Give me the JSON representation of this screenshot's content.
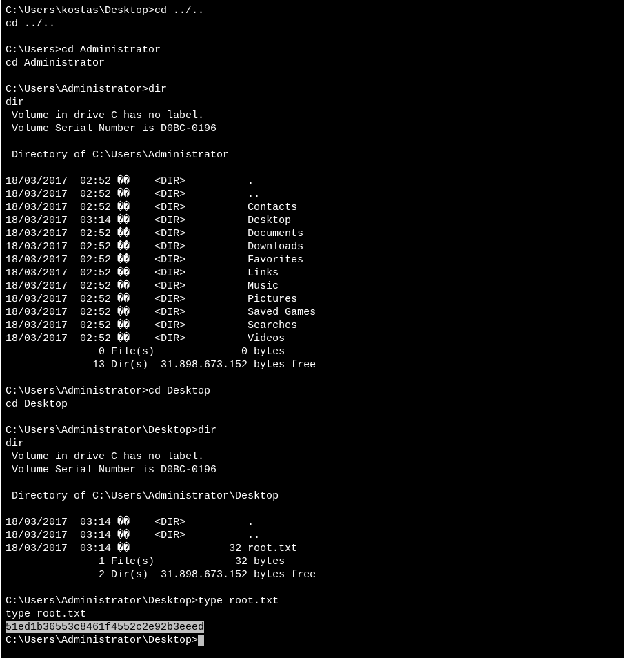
{
  "lines": [
    {
      "prompt": "C:\\Users\\kostas\\Desktop>",
      "cmd": "cd ../.."
    },
    {
      "text": "cd ../.."
    },
    {
      "text": ""
    },
    {
      "prompt": "C:\\Users>",
      "cmd": "cd Administrator"
    },
    {
      "text": "cd Administrator"
    },
    {
      "text": ""
    },
    {
      "prompt": "C:\\Users\\Administrator>",
      "cmd": "dir"
    },
    {
      "text": "dir"
    },
    {
      "text": " Volume in drive C has no label."
    },
    {
      "text": " Volume Serial Number is D0BC-0196"
    },
    {
      "text": ""
    },
    {
      "text": " Directory of C:\\Users\\Administrator"
    },
    {
      "text": ""
    },
    {
      "text": "18/03/2017  02:52 ��    <DIR>          ."
    },
    {
      "text": "18/03/2017  02:52 ��    <DIR>          .."
    },
    {
      "text": "18/03/2017  02:52 ��    <DIR>          Contacts"
    },
    {
      "text": "18/03/2017  03:14 ��    <DIR>          Desktop"
    },
    {
      "text": "18/03/2017  02:52 ��    <DIR>          Documents"
    },
    {
      "text": "18/03/2017  02:52 ��    <DIR>          Downloads"
    },
    {
      "text": "18/03/2017  02:52 ��    <DIR>          Favorites"
    },
    {
      "text": "18/03/2017  02:52 ��    <DIR>          Links"
    },
    {
      "text": "18/03/2017  02:52 ��    <DIR>          Music"
    },
    {
      "text": "18/03/2017  02:52 ��    <DIR>          Pictures"
    },
    {
      "text": "18/03/2017  02:52 ��    <DIR>          Saved Games"
    },
    {
      "text": "18/03/2017  02:52 ��    <DIR>          Searches"
    },
    {
      "text": "18/03/2017  02:52 ��    <DIR>          Videos"
    },
    {
      "text": "               0 File(s)              0 bytes"
    },
    {
      "text": "              13 Dir(s)  31.898.673.152 bytes free"
    },
    {
      "text": ""
    },
    {
      "prompt": "C:\\Users\\Administrator>",
      "cmd": "cd Desktop"
    },
    {
      "text": "cd Desktop"
    },
    {
      "text": ""
    },
    {
      "prompt": "C:\\Users\\Administrator\\Desktop>",
      "cmd": "dir"
    },
    {
      "text": "dir"
    },
    {
      "text": " Volume in drive C has no label."
    },
    {
      "text": " Volume Serial Number is D0BC-0196"
    },
    {
      "text": ""
    },
    {
      "text": " Directory of C:\\Users\\Administrator\\Desktop"
    },
    {
      "text": ""
    },
    {
      "text": "18/03/2017  03:14 ��    <DIR>          ."
    },
    {
      "text": "18/03/2017  03:14 ��    <DIR>          .."
    },
    {
      "text": "18/03/2017  03:14 ��                32 root.txt"
    },
    {
      "text": "               1 File(s)             32 bytes"
    },
    {
      "text": "               2 Dir(s)  31.898.673.152 bytes free"
    },
    {
      "text": ""
    },
    {
      "prompt": "C:\\Users\\Administrator\\Desktop>",
      "cmd": "type root.txt"
    },
    {
      "text": "type root.txt"
    },
    {
      "text": "51ed1b36553c8461f4552c2e92b3eeed",
      "highlighted": true
    },
    {
      "prompt": "C:\\Users\\Administrator\\Desktop>",
      "cmd": "",
      "cursor": true
    }
  ]
}
